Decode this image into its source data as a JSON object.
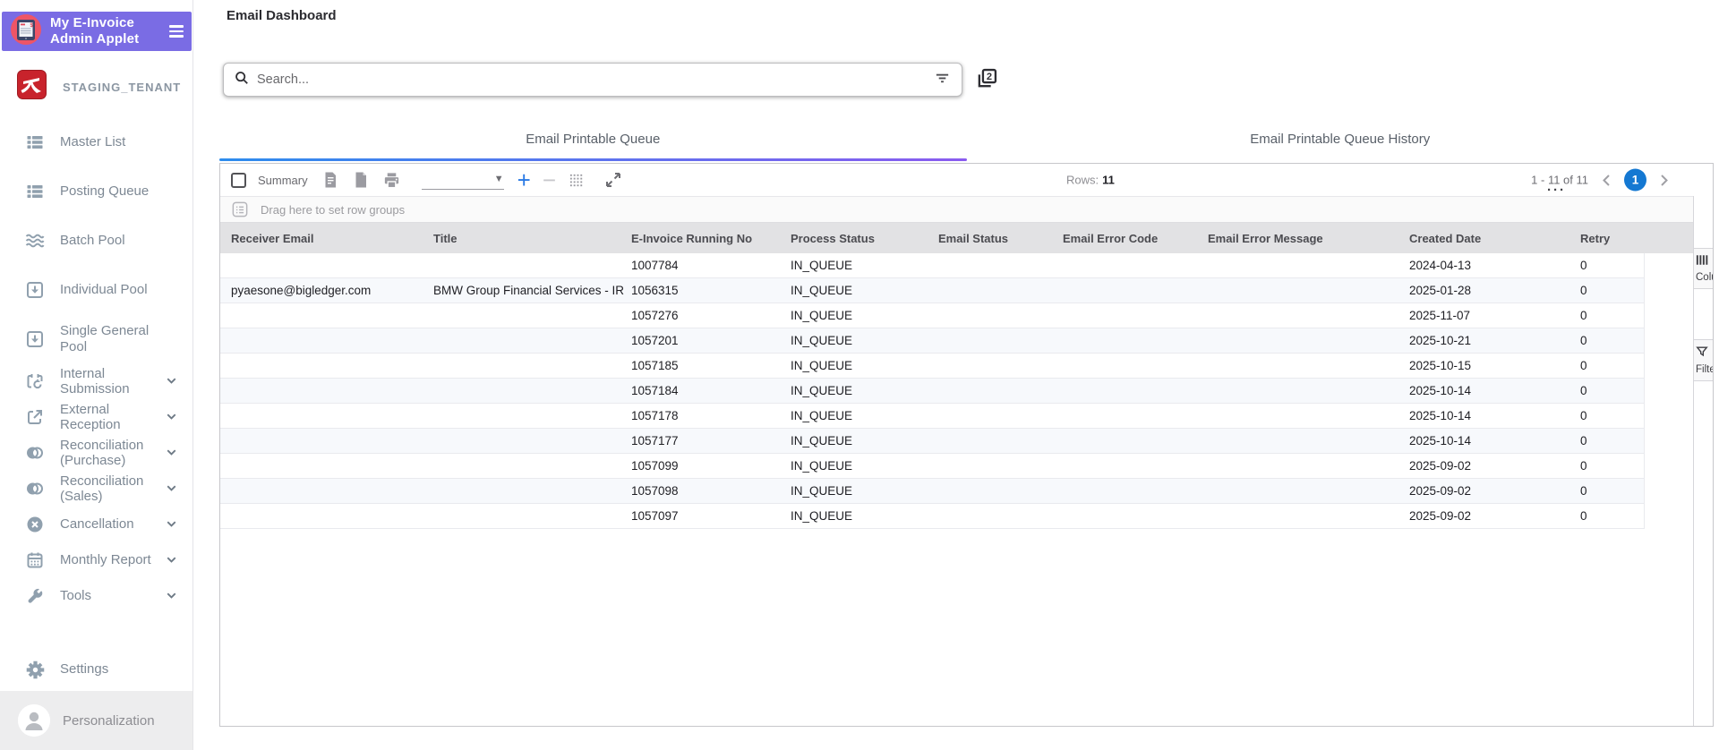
{
  "app": {
    "title_line1": "My E-Invoice",
    "title_line2": "Admin Applet",
    "tenant": "STAGING_TENANT"
  },
  "header": {
    "page_title": "Email Dashboard"
  },
  "search": {
    "placeholder": "Search...",
    "value": "",
    "stack_icon_number": "2"
  },
  "tabs": [
    {
      "label": "Email Printable Queue",
      "active": true
    },
    {
      "label": "Email Printable Queue History",
      "active": false
    }
  ],
  "sidebar": {
    "items": [
      {
        "label": "Master List",
        "icon": "list-icon",
        "chevron": false
      },
      {
        "label": "Posting Queue",
        "icon": "list-icon",
        "chevron": false
      },
      {
        "label": "Batch Pool",
        "icon": "waves-icon",
        "chevron": false
      },
      {
        "label": "Individual Pool",
        "icon": "inbox-download-icon",
        "chevron": false
      },
      {
        "label": "Single General Pool",
        "icon": "inbox-download-icon",
        "chevron": false
      },
      {
        "label": "Internal Submission",
        "icon": "calendar-refresh-icon",
        "chevron": true
      },
      {
        "label": "External Reception",
        "icon": "external-link-icon",
        "chevron": true
      },
      {
        "label": "Reconciliation (Purchase)",
        "icon": "overlap-circles-icon",
        "chevron": true
      },
      {
        "label": "Reconciliation (Sales)",
        "icon": "overlap-circles-icon",
        "chevron": true
      },
      {
        "label": "Cancellation",
        "icon": "cancel-icon",
        "chevron": true
      },
      {
        "label": "Monthly Report",
        "icon": "calendar-icon",
        "chevron": true
      },
      {
        "label": "Tools",
        "icon": "wrench-icon",
        "chevron": true
      }
    ],
    "footer": {
      "settings_label": "Settings",
      "personalization_label": "Personalization"
    }
  },
  "toolbar": {
    "summary_label": "Summary",
    "rows_label": "Rows:",
    "rows_count": "11",
    "pagination": {
      "range_text": "1 - 11 of 11",
      "current_page": "1"
    },
    "overflow_dots": "···"
  },
  "group_bar": {
    "text": "Drag here to set row groups"
  },
  "table": {
    "columns": [
      "Receiver Email",
      "Title",
      "E-Invoice Running No",
      "Process Status",
      "Email Status",
      "Email Error Code",
      "Email Error Message",
      "Created Date",
      "Retry"
    ],
    "rows": [
      {
        "receiver_email": "",
        "title": "",
        "running_no": "1007784",
        "process_status": "IN_QUEUE",
        "email_status": "",
        "error_code": "",
        "error_message": "",
        "created_date": "2024-04-13",
        "retry": "0"
      },
      {
        "receiver_email": "pyaesone@bigledger.com",
        "title": "BMW Group Financial Services - IR",
        "running_no": "1056315",
        "process_status": "IN_QUEUE",
        "email_status": "",
        "error_code": "",
        "error_message": "",
        "created_date": "2025-01-28",
        "retry": "0"
      },
      {
        "receiver_email": "",
        "title": "",
        "running_no": "1057276",
        "process_status": "IN_QUEUE",
        "email_status": "",
        "error_code": "",
        "error_message": "",
        "created_date": "2025-11-07",
        "retry": "0"
      },
      {
        "receiver_email": "",
        "title": "",
        "running_no": "1057201",
        "process_status": "IN_QUEUE",
        "email_status": "",
        "error_code": "",
        "error_message": "",
        "created_date": "2025-10-21",
        "retry": "0"
      },
      {
        "receiver_email": "",
        "title": "",
        "running_no": "1057185",
        "process_status": "IN_QUEUE",
        "email_status": "",
        "error_code": "",
        "error_message": "",
        "created_date": "2025-10-15",
        "retry": "0"
      },
      {
        "receiver_email": "",
        "title": "",
        "running_no": "1057184",
        "process_status": "IN_QUEUE",
        "email_status": "",
        "error_code": "",
        "error_message": "",
        "created_date": "2025-10-14",
        "retry": "0"
      },
      {
        "receiver_email": "",
        "title": "",
        "running_no": "1057178",
        "process_status": "IN_QUEUE",
        "email_status": "",
        "error_code": "",
        "error_message": "",
        "created_date": "2025-10-14",
        "retry": "0"
      },
      {
        "receiver_email": "",
        "title": "",
        "running_no": "1057177",
        "process_status": "IN_QUEUE",
        "email_status": "",
        "error_code": "",
        "error_message": "",
        "created_date": "2025-10-14",
        "retry": "0"
      },
      {
        "receiver_email": "",
        "title": "",
        "running_no": "1057099",
        "process_status": "IN_QUEUE",
        "email_status": "",
        "error_code": "",
        "error_message": "",
        "created_date": "2025-09-02",
        "retry": "0"
      },
      {
        "receiver_email": "",
        "title": "",
        "running_no": "1057098",
        "process_status": "IN_QUEUE",
        "email_status": "",
        "error_code": "",
        "error_message": "",
        "created_date": "2025-09-02",
        "retry": "0"
      },
      {
        "receiver_email": "",
        "title": "",
        "running_no": "1057097",
        "process_status": "IN_QUEUE",
        "email_status": "",
        "error_code": "",
        "error_message": "",
        "created_date": "2025-09-02",
        "retry": "0"
      }
    ]
  },
  "side_panel": {
    "tabs": [
      {
        "label": "Columns",
        "icon": "columns-icon"
      },
      {
        "label": "Filters",
        "icon": "funnel-icon"
      }
    ]
  },
  "colors": {
    "purple": "#7a6ce4",
    "pagination_blue": "#1478d2",
    "underline_gradient_start": "#2d8ced",
    "underline_gradient_end": "#8a5bef",
    "tenant_logo_red": "#c8232c",
    "app_icon_red": "#ee5566",
    "header_row_bg": "#e2e2e4",
    "row_stripe_bg": "#f7f9fc"
  }
}
